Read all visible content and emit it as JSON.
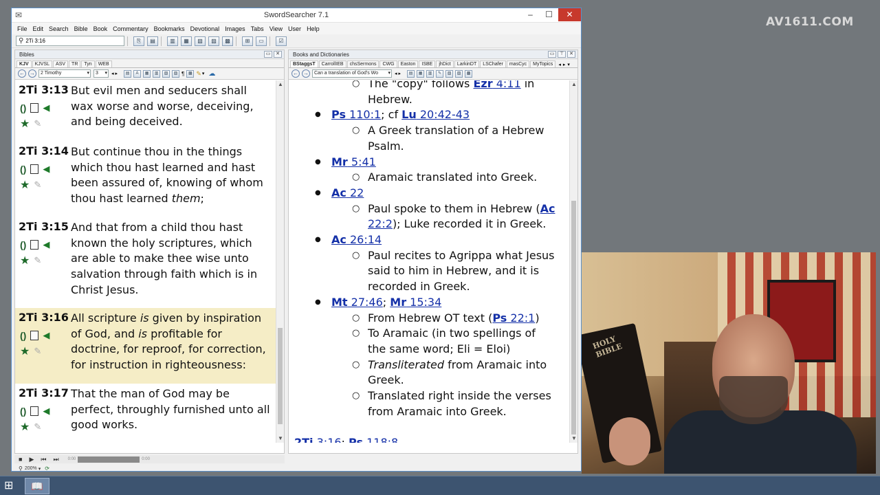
{
  "watermark": "AV1611.COM",
  "window": {
    "title": "SwordSearcher 7.1",
    "minimize": "–",
    "maximize": "☐",
    "close": "✕"
  },
  "menu": [
    "File",
    "Edit",
    "Search",
    "Bible",
    "Book",
    "Commentary",
    "Bookmarks",
    "Devotional",
    "Images",
    "Tabs",
    "View",
    "User",
    "Help"
  ],
  "toolbar": {
    "search_value": "2Ti 3:16"
  },
  "bibles_pane": {
    "header": "Bibles",
    "tabs": [
      "KJV",
      "KJVSL",
      "ASV",
      "TR",
      "Tyn",
      "WEB"
    ],
    "active_tab": "KJV",
    "book_select": "2 Timothy",
    "chapter_select": "3",
    "verses": [
      {
        "ref": "2Ti 3:13",
        "text": "But evil men and seducers shall wax worse and worse, deceiving, and being deceived.",
        "highlight": false
      },
      {
        "ref": "2Ti 3:14",
        "text_parts": [
          "But continue thou in the things which thou hast learned and hast been assured of, knowing of whom thou hast learned ",
          "them",
          ";"
        ],
        "highlight": false
      },
      {
        "ref": "2Ti 3:15",
        "text": "And that from a child thou hast known the holy scriptures, which are able to make thee wise unto salvation through faith which is in Christ Jesus.",
        "highlight": false
      },
      {
        "ref": "2Ti 3:16",
        "text_parts": [
          "All scripture ",
          "is",
          " given by inspiration of God, and ",
          "is",
          " profitable for doctrine, for reproof, for correction, for instruction in righteousness:"
        ],
        "highlight": true
      },
      {
        "ref": "2Ti 3:17",
        "text": "That the man of God may be perfect, throughly furnished unto all good works.",
        "highlight": false
      }
    ],
    "media": {
      "start_time": "0:00",
      "end_time": "0:00"
    },
    "zoom": "200%"
  },
  "books_pane": {
    "header": "Books and Dictionaries",
    "tabs": [
      "BStaggsT",
      "CarrollIEB",
      "chsSermons",
      "CWG",
      "Easton",
      "ISBE",
      "jhDict",
      "LarkinDT",
      "LSChafer",
      "masCyc",
      "MyTopics"
    ],
    "active_tab": "BStaggsT",
    "topic_select": "Can a translation of God's Wo",
    "items": {
      "top_sub": [
        "The \"copy\" follows ",
        "Ezr",
        " 4:11",
        " in Hebrew."
      ],
      "ps110": {
        "book": "Ps",
        "ref": " 110:1",
        "sep": "; cf ",
        "book2": "Lu",
        "ref2": " 20:42-43",
        "sub": "A Greek translation of a Hebrew Psalm."
      },
      "mr541": {
        "book": "Mr",
        "ref": " 5:41",
        "sub": "Aramaic translated into Greek."
      },
      "ac22": {
        "book": "Ac",
        "ref": " 22",
        "sub_pre": "Paul spoke to them in Hebrew (",
        "sub_book": "Ac",
        "sub_ref": " 22:2",
        "sub_post": "); Luke recorded it in Greek."
      },
      "ac2614": {
        "book": "Ac",
        "ref": " 26:14",
        "sub": "Paul recites to Agrippa what Jesus said to him in Hebrew, and it is recorded in Greek."
      },
      "mt2746": {
        "book": "Mt",
        "ref": " 27:46",
        "sep": "; ",
        "book2": "Mr",
        "ref2": " 15:34",
        "sub1_pre": "From Hebrew OT text (",
        "sub1_book": "Ps",
        "sub1_ref": " 22:1",
        "sub1_post": ")",
        "sub2": "To Aramaic (in two spellings of the same word; Eli = Eloi)",
        "sub3_em": "Transliterated",
        "sub3": " from Aramaic into Greek.",
        "sub4": "Translated right inside the verses from Aramaic into Greek."
      }
    },
    "footer": {
      "book1": "2Ti",
      "ref1": " 3:16",
      "sep": "; ",
      "book2": "Ps",
      "ref2": " 118:8"
    }
  },
  "webcam": {
    "book_label": "HOLY BIBLE"
  }
}
